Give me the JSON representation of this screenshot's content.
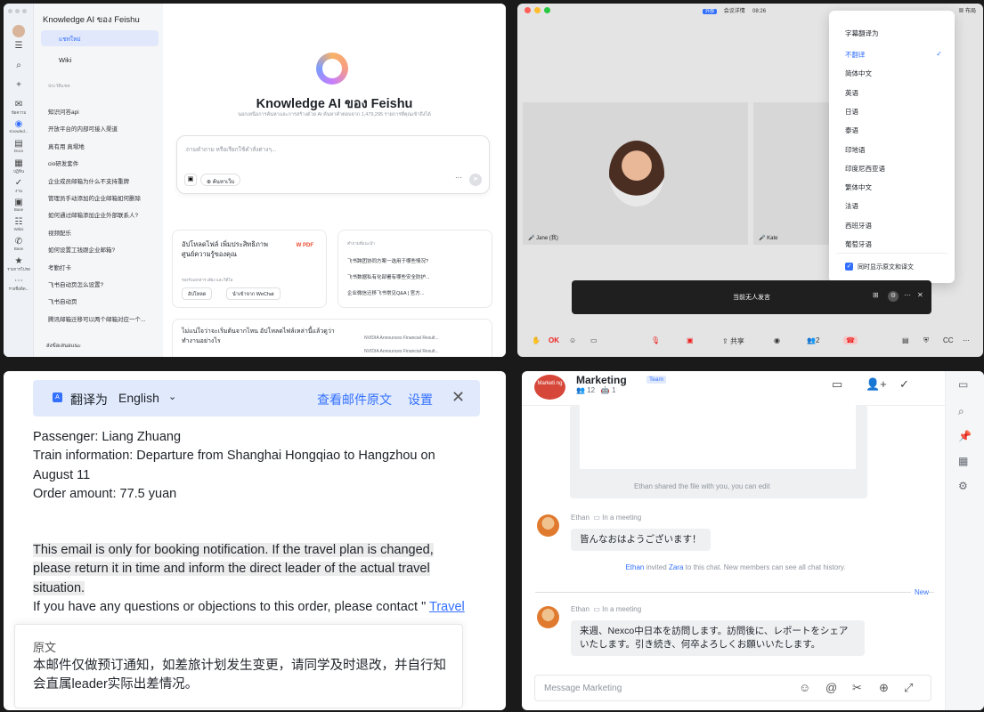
{
  "q1": {
    "rail": [
      {
        "glyph": "☰",
        "label": ""
      },
      {
        "glyph": "⌕",
        "label": ""
      },
      {
        "glyph": "+",
        "label": ""
      },
      {
        "glyph": "✉",
        "label": "ข้อความ"
      },
      {
        "glyph": "◉",
        "label": "Knowled..."
      },
      {
        "glyph": "▤",
        "label": "Docs"
      },
      {
        "glyph": "▦",
        "label": "ปฏิทิน"
      },
      {
        "glyph": "✓",
        "label": "งาน"
      },
      {
        "glyph": "▣",
        "label": "Base"
      },
      {
        "glyph": "☷",
        "label": "Wikis"
      },
      {
        "glyph": "✆",
        "label": "Base"
      },
      {
        "glyph": "★",
        "label": "รายการโปรด"
      },
      {
        "glyph": "⋯",
        "label": "รายชื่อติด..."
      }
    ],
    "sidebar": {
      "title": "Knowledge AI ของ Feishu",
      "new_chat": "แชทใหม่",
      "wiki": "Wiki",
      "section": "ประวัติแชท",
      "history": [
        "知识问答api",
        "开放平台的内部可接入渠道",
        "真有用 真場地",
        "cio研发套件",
        "企业成员邮箱为什么不支持重牌",
        "管理员手动添加的企业邮箱如何删除",
        "如何通过邮箱添加企业外部联系人?",
        "视频配乐",
        "如何设置工钱跟企业邮箱?",
        "考勤打卡",
        "飞书自动页怎么设置?",
        "飞书自动页",
        "腾讯邮箱迁移可以两个邮箱对应一个..."
      ],
      "footer": "ส่งข้อเสนอแนะ"
    },
    "main": {
      "title": "Knowledge AI ของ Feishu",
      "subtitle": "นอกเหนือการค้นหาและการสร้างด้วย AI ค้นหาคำตอบจาก 1,479,295 รายการที่คุณเข้าถึงได้",
      "input_placeholder": "ถามคำถาม หรือเรียกใช้คำสั่งต่างๆ...",
      "web_button": "ค้นหาเว็บ",
      "upload_card": {
        "title": "อัปโหลดไฟล์ เพิ่มประสิทธิภาพศูนย์ความรู้ของคุณ",
        "sub": "รองรับเอกสาร เสียง และวิดีโอ",
        "btn1": "อัปโหลด",
        "btn2": "นำเข้าจาก WeChat",
        "file_a": "W",
        "file_b": "PDF"
      },
      "suggest_card": {
        "header": "คำถามที่แนะนำ",
        "items": [
          "飞书跨团协同方案一选用于哪些情况?",
          "飞书数据私有化部署有哪些安全防护...",
          "企业微信迁移飞书常见Q&A | 官方..."
        ]
      },
      "bottom_card": {
        "text": "ไม่แน่ใจว่าจะเริ่มต้นจากไหน อัปโหลดไฟล์เหล่านี้แล้วดูว่าทำงานอย่างไร",
        "items": [
          "NVIDIA Announces Financial Result...",
          "NVIDIA Announces Financial Result..."
        ]
      }
    }
  },
  "q2": {
    "topbar": {
      "tag": "外部",
      "title": "会议详情",
      "time": "08:26",
      "right": "布局"
    },
    "participants": [
      "Jane (我)",
      "Kate"
    ],
    "menu": {
      "header": "字幕翻译为",
      "items": [
        "不翻译",
        "简体中文",
        "英语",
        "日语",
        "泰语",
        "印地语",
        "印度尼西亚语",
        "繁体中文",
        "法语",
        "西班牙语",
        "葡萄牙语"
      ],
      "selected": "不翻译",
      "checkbox_label": "同时显示原文和译文"
    },
    "subtitle_bar": "当前无人发言",
    "controls": {
      "ok": "OK",
      "share": "共享",
      "count": "2"
    }
  },
  "q3": {
    "translate_bar": {
      "label": "翻译为",
      "language": "English",
      "view_original": "查看邮件原文",
      "settings": "设置"
    },
    "lines": {
      "l1": "Passenger: Liang Zhuang",
      "l2": "Train information: Departure from Shanghai Hongqiao to Hangzhou on",
      "l3": "August 11",
      "l4": "Order amount: 77.5 yuan",
      "l5": "This email is only for booking notification. If the travel plan is changed,",
      "l6": "please return it in time and inform the direct leader of the actual travel",
      "l7": "situation.",
      "l8": "If you have any questions or objections to this order, please contact \"",
      "l8_link": "Travel"
    },
    "original": {
      "header": "原文",
      "text": "本邮件仅做预订通知，如差旅计划发生变更，请同学及时退改，并自行知会直属leader实际出差情况。"
    }
  },
  "q4": {
    "group": {
      "avatar": "Marketi ng",
      "name": "Marketing",
      "tag": "Team",
      "members": "12",
      "bots": "1"
    },
    "file_share": "Ethan shared the file with you, you can edit",
    "msg1": {
      "sender": "Ethan",
      "status": "In a meeting",
      "text": "皆んなおはようございます！"
    },
    "system": {
      "actor": "Ethan",
      "mid": " invited ",
      "target": "Zara",
      "tail": " to this chat. New members can see all chat history."
    },
    "new_label": "New",
    "msg2": {
      "sender": "Ethan",
      "status": "In a meeting",
      "text": "来週、Nexco中日本を訪問します。訪問後に、レポートをシェアいたします。引き続き、何卒よろしくお願いいたします。"
    },
    "input_placeholder": "Message Marketing"
  }
}
